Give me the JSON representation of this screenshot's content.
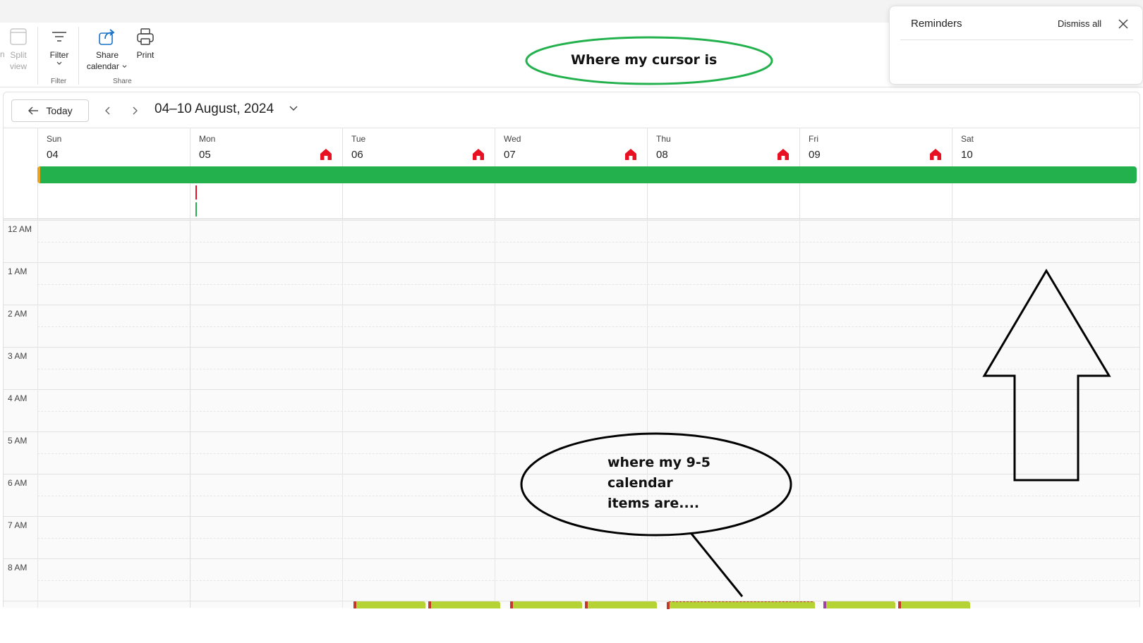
{
  "ribbon": {
    "split_view": {
      "line1": "Split",
      "line2": "view"
    },
    "filter": {
      "label": "Filter"
    },
    "share": {
      "line1": "Share",
      "line2": "calendar"
    },
    "print": {
      "label": "Print"
    },
    "groups": {
      "filter": "Filter",
      "share": "Share"
    },
    "partial_label": "n"
  },
  "navbar": {
    "today_label": "Today",
    "range_title": "04–10 August, 2024"
  },
  "days": [
    {
      "name": "Sun",
      "num": "04",
      "home": false
    },
    {
      "name": "Mon",
      "num": "05",
      "home": true
    },
    {
      "name": "Tue",
      "num": "06",
      "home": true
    },
    {
      "name": "Wed",
      "num": "07",
      "home": true
    },
    {
      "name": "Thu",
      "num": "08",
      "home": true
    },
    {
      "name": "Fri",
      "num": "09",
      "home": true
    },
    {
      "name": "Sat",
      "num": "10",
      "home": false
    }
  ],
  "hours": [
    "12 AM",
    "1 AM",
    "2 AM",
    "3 AM",
    "4 AM",
    "5 AM",
    "6 AM",
    "7 AM",
    "8 AM"
  ],
  "reminders": {
    "title": "Reminders",
    "dismiss_all": "Dismiss all"
  },
  "annotations": {
    "cursor_note": "Where my cursor is",
    "items_note_line1": "where my 9-5",
    "items_note_line2": "calendar",
    "items_note_line3": "items are...."
  },
  "colors": {
    "allday_event": "#22b14c",
    "event_fill": "#b5d334",
    "home_icon": "#e81123",
    "cursor_ellipse": "#22b14c"
  }
}
